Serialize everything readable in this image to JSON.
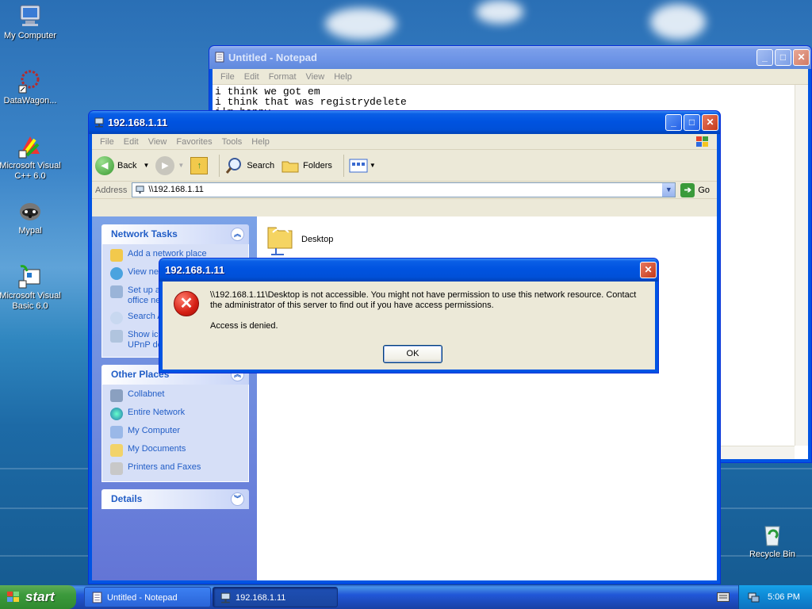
{
  "desktop": {
    "icons": [
      {
        "label": "My Computer",
        "icon": "my-computer-icon"
      },
      {
        "label": "DataWagon...",
        "icon": "datawagon-icon"
      },
      {
        "label": "Microsoft Visual C++ 6.0",
        "icon": "visual-cpp-icon"
      },
      {
        "label": "Mypal",
        "icon": "mypal-icon"
      },
      {
        "label": "Microsoft Visual Basic 6.0",
        "icon": "visual-basic-icon"
      },
      {
        "label": "Recycle Bin",
        "icon": "recycle-bin-icon"
      }
    ]
  },
  "notepad": {
    "title": "Untitled - Notepad",
    "menu": [
      "File",
      "Edit",
      "Format",
      "View",
      "Help"
    ],
    "lines": [
      "i think we got em",
      "i think that was registrydelete",
      "i'm happy"
    ]
  },
  "explorer": {
    "title": "192.168.1.11",
    "menu": [
      "File",
      "Edit",
      "View",
      "Favorites",
      "Tools",
      "Help"
    ],
    "toolbar": {
      "back": "Back",
      "search": "Search",
      "folders": "Folders"
    },
    "address": {
      "label": "Address",
      "value": "\\\\192.168.1.11",
      "go": "Go"
    },
    "network_tasks": {
      "title": "Network Tasks",
      "items": [
        "Add a network place",
        "View network connections",
        "Set up a home or small office network",
        "Search Active Directory",
        "Show icons for networked UPnP devices"
      ]
    },
    "other_places": {
      "title": "Other Places",
      "items": [
        "Collabnet",
        "Entire Network",
        "My Computer",
        "My Documents",
        "Printers and Faxes"
      ]
    },
    "details": {
      "title": "Details"
    },
    "files": [
      {
        "name": "Desktop",
        "icon": "shared-folder-icon"
      }
    ]
  },
  "dialog": {
    "title": "192.168.1.11",
    "message": "\\\\192.168.1.11\\Desktop is not accessible. You might not have permission to use this network resource. Contact the administrator of this server to find out if you have access permissions.",
    "detail": "Access is denied.",
    "ok": "OK"
  },
  "taskbar": {
    "start": "start",
    "items": [
      {
        "label": "Untitled - Notepad",
        "icon": "notepad-icon",
        "active": false
      },
      {
        "label": "192.168.1.11",
        "icon": "network-drive-icon",
        "active": true
      }
    ],
    "clock": "5:06 PM"
  },
  "colors": {
    "titlebar_active": "#0054E3",
    "taskbar": "#245EDC",
    "start_green": "#3C9A3C",
    "task_link": "#215DC6"
  }
}
